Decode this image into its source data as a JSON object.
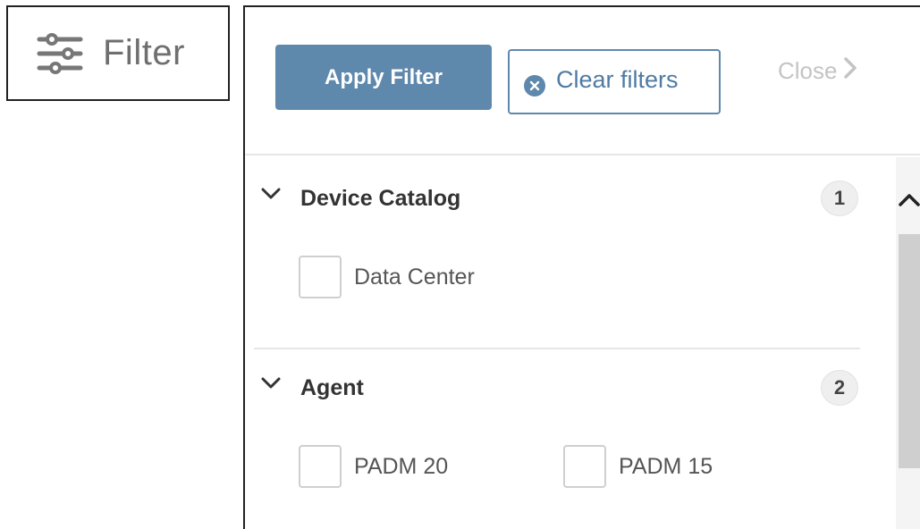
{
  "filter_toggle": {
    "label": "Filter",
    "icon": "sliders-icon"
  },
  "header": {
    "apply_label": "Apply Filter",
    "clear_label": "Clear filters",
    "close_label": "Close"
  },
  "sections": [
    {
      "title": "Device Catalog",
      "count": "1",
      "options": [
        {
          "label": "Data Center",
          "checked": false
        }
      ]
    },
    {
      "title": "Agent",
      "count": "2",
      "options": [
        {
          "label": "PADM 20",
          "checked": false
        },
        {
          "label": "PADM 15",
          "checked": false
        }
      ]
    }
  ],
  "colors": {
    "primary": "#5f88ad",
    "muted_text": "#c4c4c4"
  }
}
